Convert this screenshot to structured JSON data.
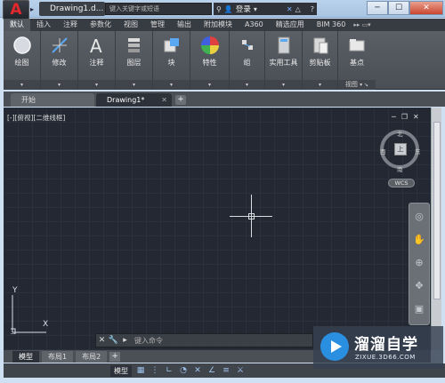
{
  "title_bar": {
    "app_logo": "A",
    "doc_title": "Drawing1.d...",
    "search_placeholder": "键入关键字或短语",
    "login": "登录",
    "help": "?"
  },
  "ribbon_tabs": [
    "默认",
    "插入",
    "注释",
    "参数化",
    "视图",
    "管理",
    "输出",
    "附加模块",
    "A360",
    "精选应用",
    "BIM 360"
  ],
  "ribbon_panels": [
    {
      "label": "绘图"
    },
    {
      "label": "修改"
    },
    {
      "label": "注释"
    },
    {
      "label": "图层"
    },
    {
      "label": "块"
    },
    {
      "label": "特性"
    },
    {
      "label": "组"
    },
    {
      "label": "实用工具"
    },
    {
      "label": "剪贴板"
    },
    {
      "label": "基点"
    }
  ],
  "view_panel_footer": "视图",
  "file_tabs": {
    "start": "开始",
    "drawing": "Drawing1*",
    "plus": "+"
  },
  "viewport": {
    "label": "[-][俯视][二维线框]"
  },
  "viewcube": {
    "top": "上",
    "north": "北",
    "south": "南",
    "west": "西",
    "east": "东",
    "wcs": "WCS"
  },
  "ucs": {
    "x": "X",
    "y": "Y"
  },
  "command_line": {
    "placeholder": "键入命令"
  },
  "layout_tabs": {
    "model": "模型",
    "layout1": "布局1",
    "layout2": "布局2",
    "plus": "+"
  },
  "status_bar": {
    "model": "模型"
  },
  "watermark": {
    "title": "溜溜自学",
    "url": "ZIXUE.3D66.COM"
  }
}
